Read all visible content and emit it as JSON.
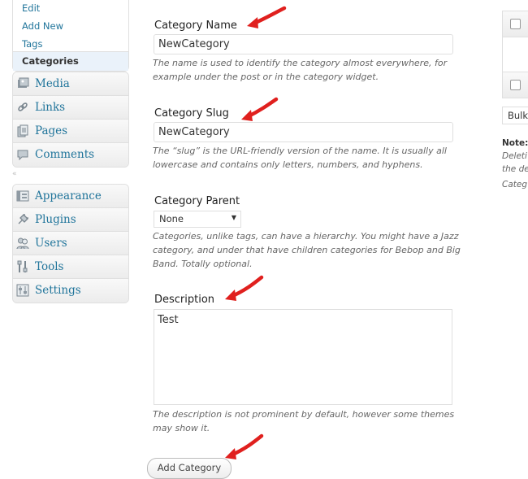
{
  "menu": {
    "posts_submenu": [
      {
        "label": "Edit"
      },
      {
        "label": "Add New"
      },
      {
        "label": "Tags"
      }
    ],
    "current_submenu": "Categories",
    "group1": [
      {
        "label": "Media",
        "icon": "media-icon"
      },
      {
        "label": "Links",
        "icon": "links-icon"
      },
      {
        "label": "Pages",
        "icon": "pages-icon"
      },
      {
        "label": "Comments",
        "icon": "comments-icon"
      }
    ],
    "group2": [
      {
        "label": "Appearance",
        "icon": "appearance-icon"
      },
      {
        "label": "Plugins",
        "icon": "plugins-icon"
      },
      {
        "label": "Users",
        "icon": "users-icon"
      },
      {
        "label": "Tools",
        "icon": "tools-icon"
      },
      {
        "label": "Settings",
        "icon": "settings-icon"
      }
    ],
    "separator": "«"
  },
  "form": {
    "name_label": "Category Name",
    "name_value": "NewCategory",
    "name_help": "The name is used to identify the category almost everywhere, for example under the post or in the category widget.",
    "slug_label": "Category Slug",
    "slug_value": "NewCategory",
    "slug_help": "The “slug” is the URL-friendly version of the name. It is usually all lowercase and contains only letters, numbers, and hyphens.",
    "parent_label": "Category Parent",
    "parent_value": "None",
    "parent_help": "Categories, unlike tags, can have a hierarchy. You might have a Jazz category, and under that have children categories for Bebop and Big Band. Totally optional.",
    "description_label": "Description",
    "description_value": "Test",
    "description_help": "The description is not prominent by default, however some themes may show it.",
    "submit_label": "Add Category"
  },
  "right_panel": {
    "bulk_actions": "Bulk",
    "note_lines": [
      "Note:",
      "Deleti",
      "the de"
    ],
    "note_tail": "Categ"
  },
  "colors": {
    "link": "#21759b",
    "arrow": "#e0201e",
    "border": "#dfdfdf"
  }
}
